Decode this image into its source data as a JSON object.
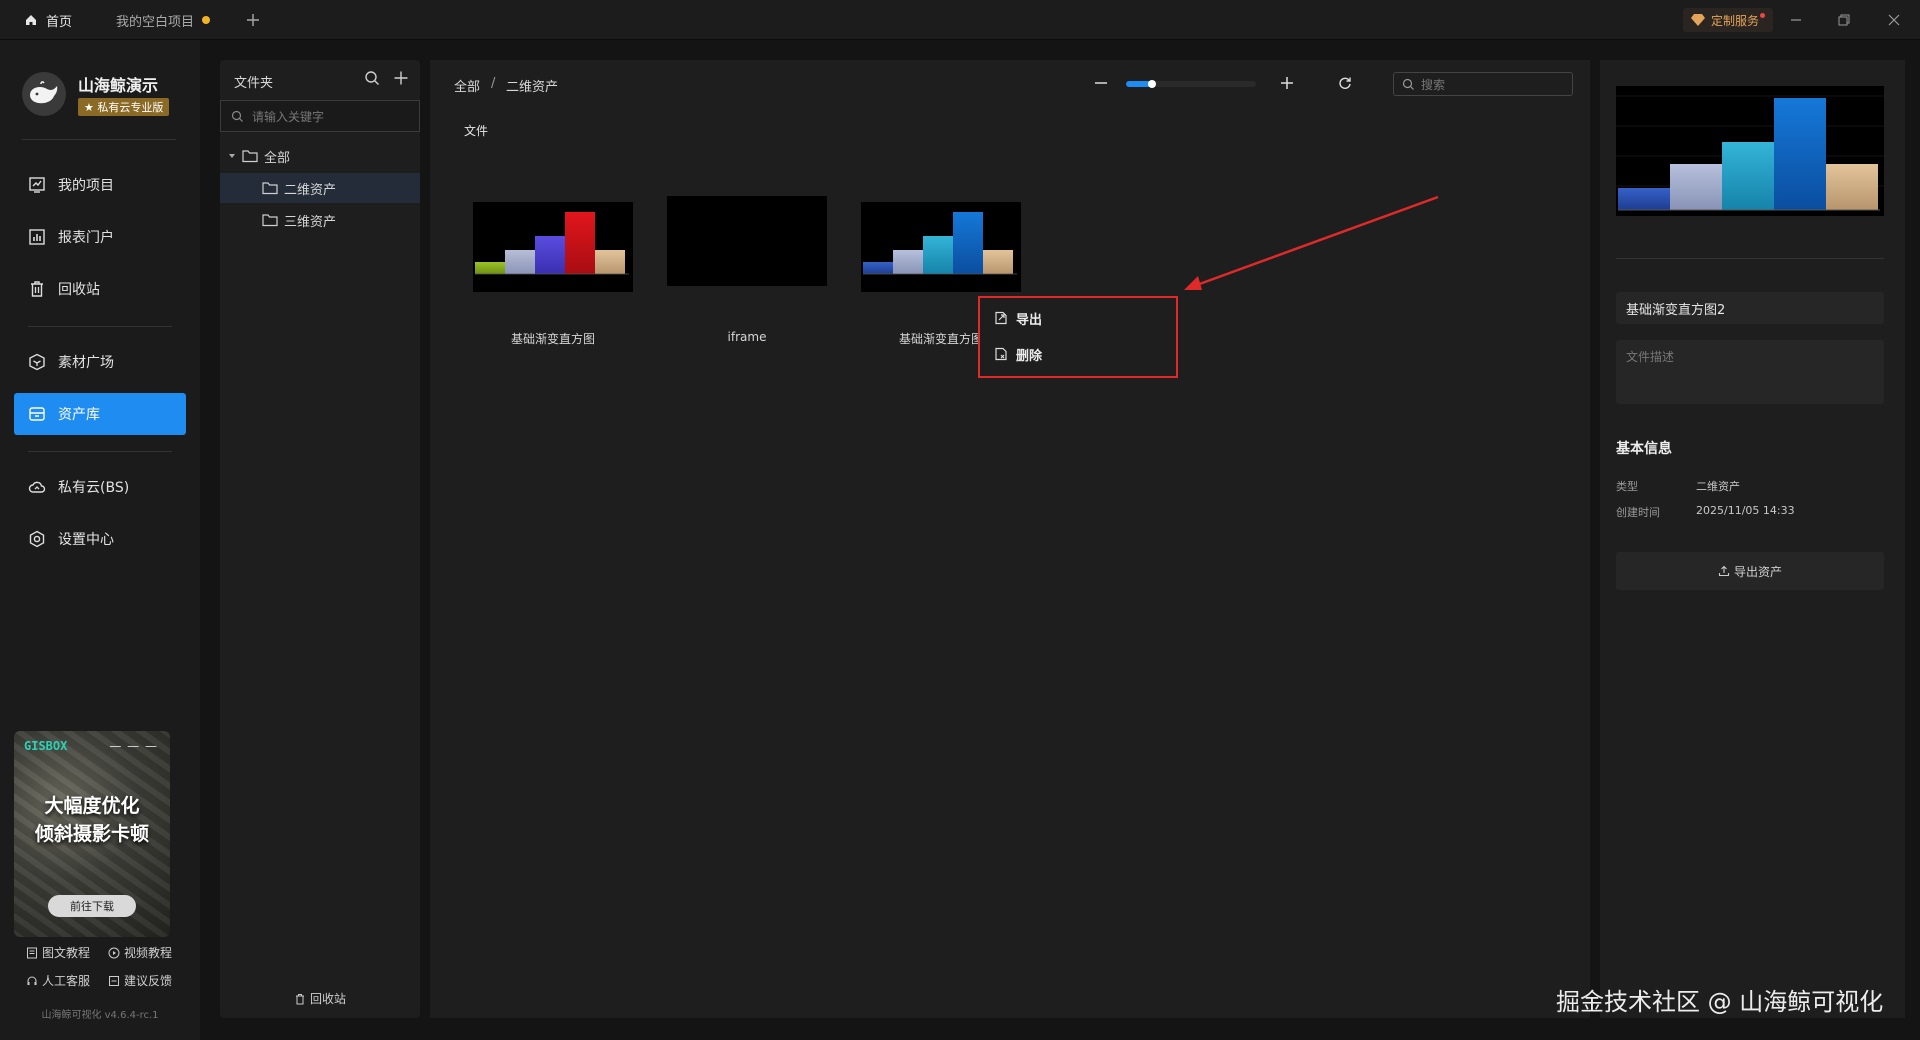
{
  "titlebar": {
    "tabs": [
      {
        "label": "首页"
      },
      {
        "label": "我的空白项目"
      }
    ],
    "custom_service": "定制服务"
  },
  "sidebar": {
    "brand_name": "山海鲸演示",
    "edition": "★ 私有云专业版",
    "nav": [
      {
        "label": "我的项目",
        "icon": "chart-line-icon"
      },
      {
        "label": "报表门户",
        "icon": "bar-chart-icon"
      },
      {
        "label": "回收站",
        "icon": "trash-icon"
      },
      {
        "label": "素材广场",
        "icon": "cube-icon"
      },
      {
        "label": "资产库",
        "icon": "archive-icon",
        "active": true
      },
      {
        "label": "私有云(BS)",
        "icon": "cloud-icon"
      },
      {
        "label": "设置中心",
        "icon": "gear-icon"
      }
    ],
    "promo": {
      "tag": "GISBOX",
      "dash": "— — —",
      "line1": "大幅度优化",
      "line2": "倾斜摄影卡顿",
      "button": "前往下载"
    },
    "help": [
      {
        "label": "图文教程"
      },
      {
        "label": "视频教程"
      },
      {
        "label": "人工客服"
      },
      {
        "label": "建议反馈"
      }
    ],
    "version": "山海鲸可视化 v4.6.4-rc.1"
  },
  "folders": {
    "title": "文件夹",
    "search_placeholder": "请输入关键字",
    "tree": [
      {
        "label": "全部"
      },
      {
        "label": "二维资产"
      },
      {
        "label": "三维资产"
      }
    ],
    "recycle": "回收站"
  },
  "main": {
    "breadcrumb": [
      "全部",
      "/",
      "二维资产"
    ],
    "section_label": "文件",
    "search_placeholder": "搜索",
    "zoom_level": 0.2,
    "files": [
      {
        "name": "基础渐变直方图",
        "thumb": "bar-chart-1"
      },
      {
        "name": "iframe",
        "thumb": "blank"
      },
      {
        "name": "基础渐变直方图",
        "thumb": "bar-chart-2"
      }
    ],
    "context_menu": [
      {
        "label": "导出",
        "icon": "export-file-icon"
      },
      {
        "label": "删除",
        "icon": "delete-file-icon"
      }
    ]
  },
  "details": {
    "asset_name": "基础渐变直方图2",
    "description_placeholder": "文件描述",
    "info_title": "基本信息",
    "info": [
      {
        "key": "类型",
        "value": "二维资产"
      },
      {
        "key": "创建时间",
        "value": "2025/11/05 14:33"
      }
    ],
    "export_button": "导出资产"
  },
  "watermark": "掘金技术社区 @ 山海鲸可视化",
  "colors": {
    "accent": "#1e8cf0",
    "highlight_border": "#e02a2a",
    "unsaved_dot": "#f0b429"
  }
}
